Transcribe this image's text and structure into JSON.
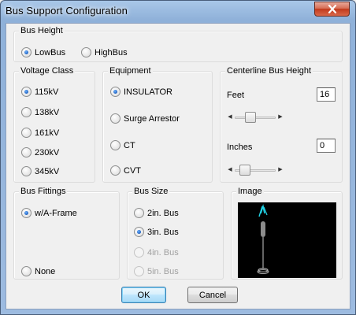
{
  "window": {
    "title": "Bus Support Configuration"
  },
  "bus_height": {
    "label": "Bus Height",
    "options": [
      "LowBus",
      "HighBus"
    ],
    "selected": "LowBus"
  },
  "voltage_class": {
    "label": "Voltage Class",
    "options": [
      "115kV",
      "138kV",
      "161kV",
      "230kV",
      "345kV"
    ],
    "selected": "115kV"
  },
  "equipment": {
    "label": "Equipment",
    "options": [
      "INSULATOR",
      "Surge Arrestor",
      "CT",
      "CVT"
    ],
    "selected": "INSULATOR"
  },
  "centerline": {
    "label": "Centerline Bus Height",
    "feet_label": "Feet",
    "feet_value": "16",
    "inches_label": "Inches",
    "inches_value": "0",
    "feet_slider_fraction": 0.35,
    "inches_slider_fraction": 0.15
  },
  "bus_fittings": {
    "label": "Bus Fittings",
    "options": [
      "w/A-Frame",
      "None"
    ],
    "selected": "w/A-Frame"
  },
  "bus_size": {
    "label": "Bus Size",
    "options": [
      "2in. Bus",
      "3in. Bus",
      "4in. Bus",
      "5in. Bus"
    ],
    "selected": "3in. Bus",
    "disabled": [
      "4in. Bus",
      "5in. Bus"
    ]
  },
  "image": {
    "label": "Image",
    "colors": {
      "background": "#000000",
      "insulator": "#9a9a9a",
      "conductor": "#22d3e6"
    }
  },
  "buttons": {
    "ok": "OK",
    "cancel": "Cancel"
  }
}
